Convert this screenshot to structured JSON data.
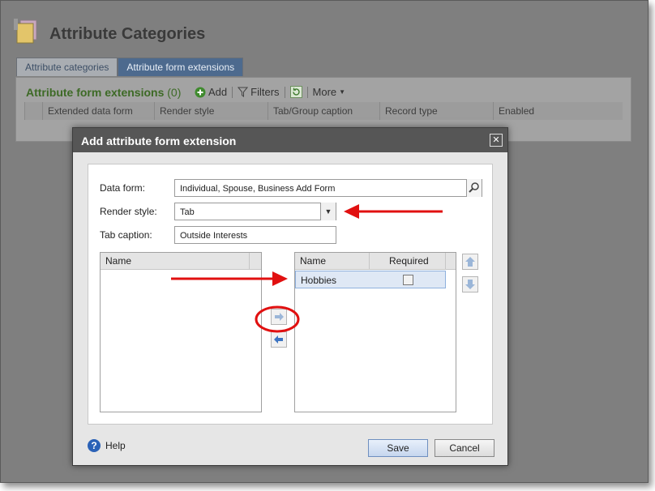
{
  "page": {
    "title": "Attribute Categories",
    "tabs": [
      {
        "label": "Attribute categories",
        "active": false
      },
      {
        "label": "Attribute form extensions",
        "active": true
      }
    ],
    "grid": {
      "title": "Attribute form extensions",
      "count": "(0)",
      "toolbar": {
        "add": "Add",
        "filters": "Filters",
        "more": "More"
      },
      "columns": [
        "Extended data form",
        "Render style",
        "Tab/Group caption",
        "Record type",
        "Enabled"
      ]
    }
  },
  "dialog": {
    "title": "Add attribute form extension",
    "close_glyph": "✕",
    "data_form": {
      "label": "Data form:",
      "value": "Individual, Spouse, Business Add Form"
    },
    "render_style": {
      "label": "Render style:",
      "value": "Tab"
    },
    "tab_caption": {
      "label": "Tab caption:",
      "value": "Outside Interests"
    },
    "available_list": {
      "header": "Name"
    },
    "selected_list": {
      "headers": {
        "name": "Name",
        "required": "Required"
      },
      "rows": [
        {
          "name": "Hobbies",
          "required": false
        }
      ]
    },
    "help": "Help",
    "buttons": {
      "save": "Save",
      "cancel": "Cancel"
    }
  },
  "colors": {
    "annotation": "#e11010",
    "tab_active": "#4d6a8e",
    "grid_title": "#3d6a26"
  }
}
